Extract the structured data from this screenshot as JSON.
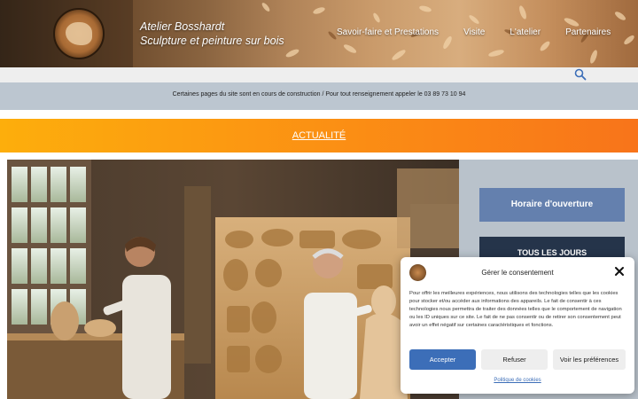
{
  "header": {
    "site_name": "Atelier Bosshardt",
    "tagline": "Sculpture et peinture sur bois",
    "nav": [
      {
        "label": "Savoir-faire et Prestations"
      },
      {
        "label": "Visite"
      },
      {
        "label": "L'atelier"
      },
      {
        "label": "Partenaires"
      }
    ]
  },
  "search": {
    "icon": "search-icon"
  },
  "notice": {
    "text": "Certaines pages du site sont en cours de construction / Pour tout renseignement appeler le 03 89 73 10 94"
  },
  "banner": {
    "label": "ACTUALITÉ",
    "colors": [
      "#fdae0c",
      "#f8741a"
    ]
  },
  "sidebar": {
    "hours_button": "Horaire d'ouverture",
    "days_button": "TOUS LES JOURS"
  },
  "cookie": {
    "title": "Gérer le consentement",
    "text": "Pour offrir les meilleures expériences, nous utilisons des technologies telles que les cookies pour stocker et/ou accéder aux informations des appareils. Le fait de consentir à ces technologies nous permettra de traiter des données telles que le comportement de navigation ou les ID uniques sur ce site. Le fait de ne pas consentir ou de retirer son consentement peut avoir un effet négatif sur certaines caractéristiques et fonctions.",
    "accept": "Accepter",
    "refuse": "Refuser",
    "preferences": "Voir les préférences",
    "policy": "Politique de cookies"
  },
  "colors": {
    "accent": "#3c6eb8",
    "hours_button": "#6480ae",
    "days_button": "#25344a",
    "notice_bg": "#bcc6d0"
  }
}
